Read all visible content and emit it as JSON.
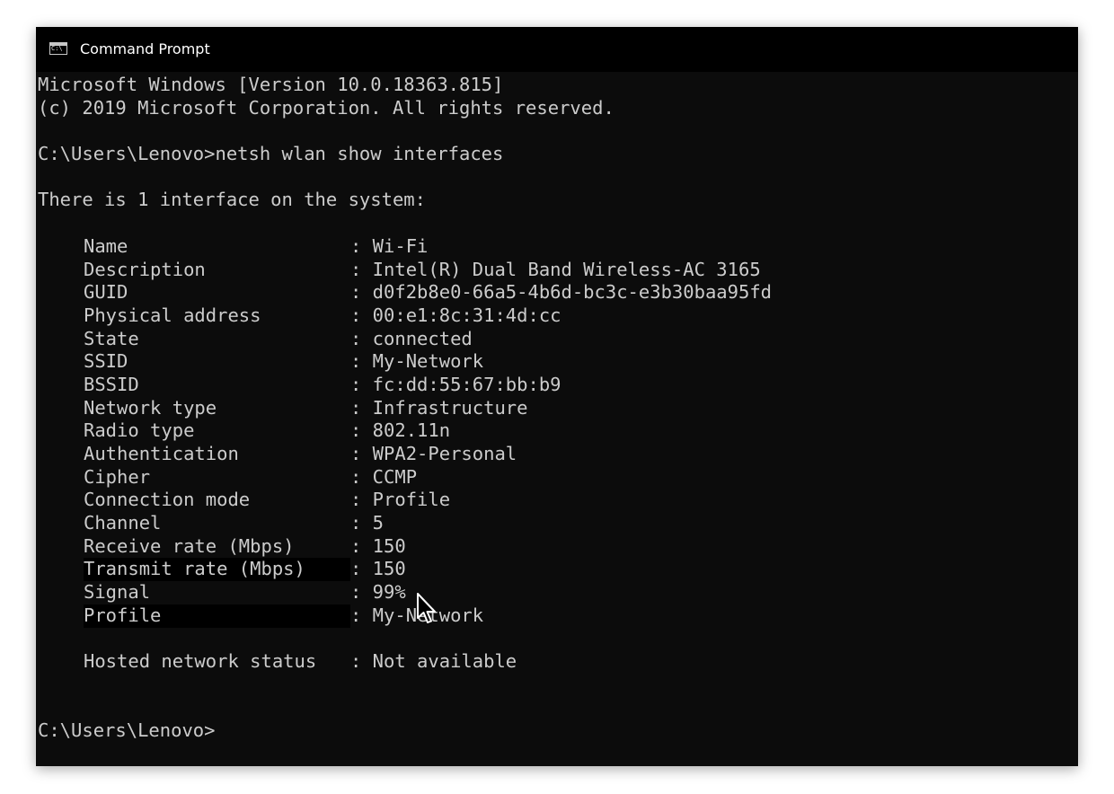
{
  "window": {
    "title": "Command Prompt",
    "icon": "cmd-icon"
  },
  "console": {
    "version_line": "Microsoft Windows [Version 10.0.18363.815]",
    "copyright_line": "(c) 2019 Microsoft Corporation. All rights reserved.",
    "command_line": "C:\\Users\\Lenovo>netsh wlan show interfaces",
    "summary_line": "There is 1 interface on the system:",
    "interface_fields": [
      {
        "label": "Name",
        "value": ": Wi-Fi"
      },
      {
        "label": "Description",
        "value": ": Intel(R) Dual Band Wireless-AC 3165"
      },
      {
        "label": "GUID",
        "value": ": d0f2b8e0-66a5-4b6d-bc3c-e3b30baa95fd"
      },
      {
        "label": "Physical address",
        "value": ": 00:e1:8c:31:4d:cc"
      },
      {
        "label": "State",
        "value": ": connected"
      },
      {
        "label": "SSID",
        "value": ": My-Network"
      },
      {
        "label": "BSSID",
        "value": ": fc:dd:55:67:bb:b9"
      },
      {
        "label": "Network type",
        "value": ": Infrastructure"
      },
      {
        "label": "Radio type",
        "value": ": 802.11n"
      },
      {
        "label": "Authentication",
        "value": ": WPA2-Personal"
      },
      {
        "label": "Cipher",
        "value": ": CCMP"
      },
      {
        "label": "Connection mode",
        "value": ": Profile"
      },
      {
        "label": "Channel",
        "value": ": 5"
      },
      {
        "label": "Receive rate (Mbps)",
        "value": ": 150"
      },
      {
        "label": "Transmit rate (Mbps)",
        "value": ": 150"
      },
      {
        "label": "Signal",
        "value": ": 99%"
      },
      {
        "label": "Profile",
        "value": ": My-Network"
      }
    ],
    "hosted_network": {
      "label": "Hosted network status",
      "value": ": Not available"
    },
    "prompt": "C:\\Users\\Lenovo>"
  },
  "colors": {
    "console_background": "#0c0c0c",
    "console_text": "#cccccc",
    "titlebar_background": "#000000",
    "titlebar_text": "#ffffff"
  },
  "cursor": {
    "icon": "mouse-pointer-icon"
  }
}
